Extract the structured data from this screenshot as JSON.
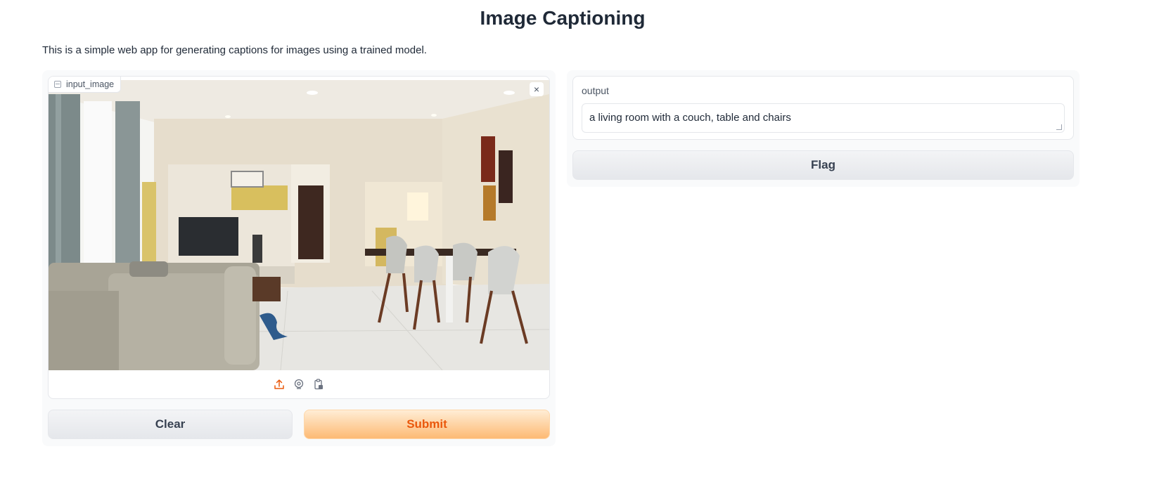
{
  "page": {
    "title": "Image Captioning",
    "description": "This is a simple web app for generating captions for images using a trained model."
  },
  "input": {
    "label": "input_image",
    "close_glyph": "×",
    "toolbar_icons": [
      "upload-icon",
      "webcam-icon",
      "clipboard-icon"
    ],
    "image_alt": "a living room with a couch, table and chairs"
  },
  "buttons": {
    "clear": "Clear",
    "submit": "Submit",
    "flag": "Flag"
  },
  "output": {
    "label": "output",
    "value": "a living room with a couch, table and chairs"
  },
  "colors": {
    "accent": "#ea580c",
    "accent_light": "#fdba74",
    "panel_bg": "#f9fafb",
    "border": "#e5e7eb"
  }
}
